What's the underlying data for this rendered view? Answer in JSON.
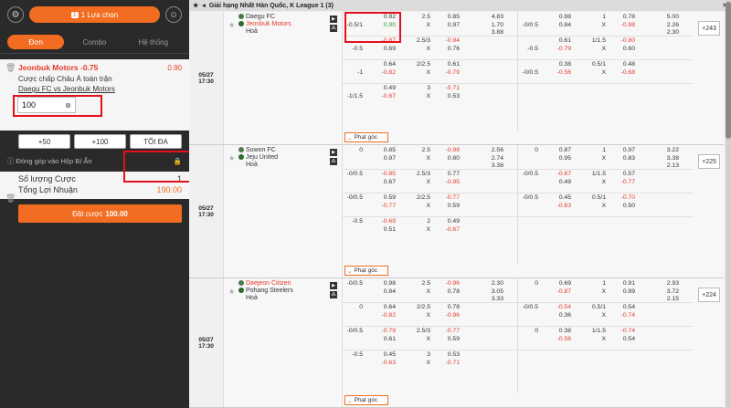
{
  "left": {
    "selection_label": "1 Lựa chọn",
    "selection_count": "1",
    "tabs": [
      "Đơn",
      "Combo",
      "Hệ thống"
    ],
    "slip": {
      "selection": "Jeonbuk Motors -0.75",
      "odd": "0.90",
      "market": "Cược chấp Châu Á toàn trận",
      "match": "Daegu FC vs Jeonbuk Motors",
      "stake": "100"
    },
    "quick": [
      "+50",
      "+100",
      "TỐI ĐA"
    ],
    "hide_label": "Đóng góp vào Hộp Bí Ẩn",
    "summary": {
      "count_label": "Số lượng Cược",
      "count_value": "1",
      "profit_label": "Tổng Lợi Nhuận",
      "profit_value": "190.00"
    },
    "place_label": "Đặt cược",
    "place_amount": "100.00"
  },
  "league": "Giải hạng Nhất Hàn Quốc, K League 1 (3)",
  "phat_goc": "Phạt góc",
  "matches": [
    {
      "date": "05/27",
      "time": "17:30",
      "home": "Daegu FC",
      "away": "Jeonbuk Motors",
      "draw": "Hoà",
      "count": "+243",
      "rows": [
        [
          "",
          "0.92",
          "2.5",
          "0.85",
          "4.83",
          "",
          "0.98",
          "1",
          "0.78",
          "5.00"
        ],
        [
          "-0.5/1",
          "0.90",
          "X",
          "0.97",
          "1.70",
          "-0/0.5",
          "0.84",
          "X",
          "-0.98",
          "2.26"
        ],
        [
          "",
          "",
          "",
          "",
          "3.88",
          "",
          "",
          "",
          "",
          "2.30"
        ],
        [
          "",
          "-0.87",
          "2.5/3",
          "-0.94",
          "",
          "",
          "0.61",
          "1/1.5",
          "-0.80",
          ""
        ],
        [
          "-0.5",
          "0.69",
          "X",
          "0.76",
          "",
          "-0.5",
          "-0.79",
          "X",
          "0.60",
          ""
        ],
        [
          "",
          "0.64",
          "2/2.5",
          "0.61",
          "",
          "",
          "0.38",
          "0.5/1",
          "0.48",
          ""
        ],
        [
          "-1",
          "-0.82",
          "X",
          "-0.79",
          "",
          "-0/0.5",
          "-0.56",
          "X",
          "-0.68",
          ""
        ],
        [
          "",
          "0.49",
          "3",
          "-0.71",
          "",
          "",
          "",
          "",
          "",
          ""
        ],
        [
          "-1/1.5",
          "-0.67",
          "X",
          "0.53",
          "",
          "",
          "",
          "",
          "",
          ""
        ]
      ]
    },
    {
      "date": "05/27",
      "time": "17:30",
      "home": "Suwon FC",
      "away": "Jeju United",
      "draw": "Hoà",
      "count": "+225",
      "rows": [
        [
          "0",
          "0.85",
          "2.5",
          "-0.98",
          "2.56",
          "0",
          "0.87",
          "1",
          "0.97",
          "3.22"
        ],
        [
          "",
          "0.97",
          "X",
          "0.80",
          "2.74",
          "",
          "0.95",
          "X",
          "0.83",
          "3.38"
        ],
        [
          "",
          "",
          "",
          "",
          "3.38",
          "",
          "",
          "",
          "",
          "2.13"
        ],
        [
          "-0/0.5",
          "-0.85",
          "2.5/3",
          "0.77",
          "",
          "-0/0.5",
          "-0.67",
          "1/1.5",
          "0.57",
          ""
        ],
        [
          "",
          "0.67",
          "X",
          "-0.95",
          "",
          "",
          "0.49",
          "X",
          "-0.77",
          ""
        ],
        [
          "-0/0.5",
          "0.59",
          "2/2.5",
          "-0.77",
          "",
          "-0/0.5",
          "0.45",
          "0.5/1",
          "-0.70",
          ""
        ],
        [
          "",
          "-0.77",
          "X",
          "0.59",
          "",
          "",
          "-0.63",
          "X",
          "0.50",
          ""
        ],
        [
          "-0.5",
          "-0.69",
          "2",
          "0.49",
          "",
          "",
          "",
          "",
          "",
          ""
        ],
        [
          "",
          "0.51",
          "X",
          "-0.67",
          "",
          "",
          "",
          "",
          "",
          ""
        ]
      ]
    },
    {
      "date": "05/27",
      "time": "17:30",
      "home": "Daejeon Citizen",
      "away": "Pohang Steelers",
      "draw": "Hoà",
      "count": "+224",
      "rows": [
        [
          "-0/0.5",
          "0.98",
          "2.5",
          "-0.96",
          "2.30",
          "0",
          "0.69",
          "1",
          "0.91",
          "2.93"
        ],
        [
          "",
          "0.84",
          "X",
          "0.78",
          "3.05",
          "",
          "-0.87",
          "X",
          "0.89",
          "3.72"
        ],
        [
          "",
          "",
          "",
          "",
          "3.33",
          "",
          "",
          "",
          "",
          "2.15"
        ],
        [
          "0",
          "0.64",
          "2/2.5",
          "0.78",
          "",
          "-0/0.5",
          "-0.54",
          "0.5/1",
          "0.54",
          ""
        ],
        [
          "",
          "-0.82",
          "X",
          "-0.96",
          "",
          "",
          "0.36",
          "X",
          "-0.74",
          ""
        ],
        [
          "-0/0.5",
          "-0.79",
          "2.5/3",
          "-0.77",
          "",
          "0",
          "0.38",
          "1/1.5",
          "-0.74",
          ""
        ],
        [
          "",
          "0.61",
          "X",
          "0.59",
          "",
          "",
          "-0.56",
          "X",
          "0.54",
          ""
        ],
        [
          "-0.5",
          "0.45",
          "3",
          "0.53",
          "",
          "",
          "",
          "",
          "",
          ""
        ],
        [
          "",
          "-0.63",
          "X",
          "-0.71",
          "",
          "",
          "",
          "",
          "",
          ""
        ]
      ]
    }
  ]
}
